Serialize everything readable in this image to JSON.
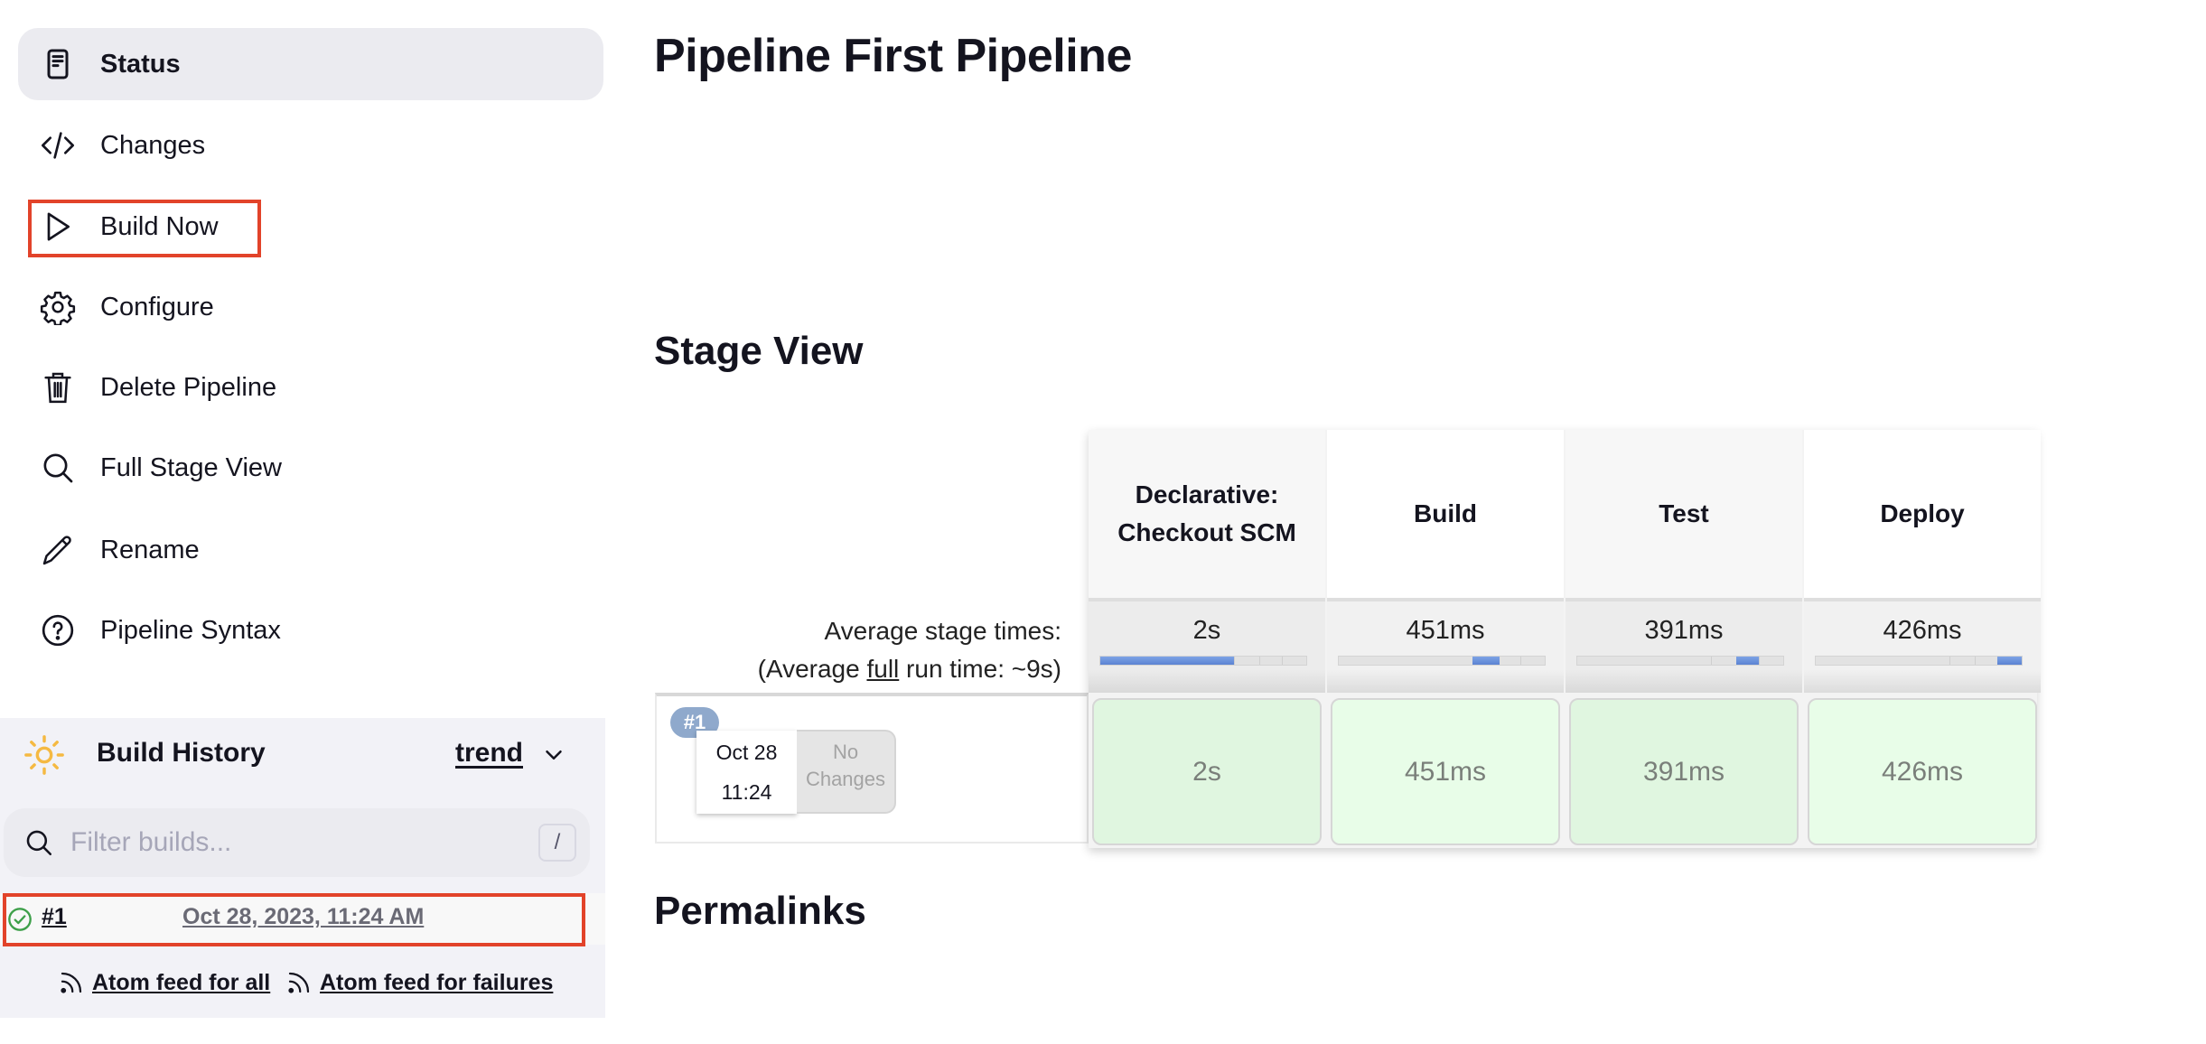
{
  "sidebar": {
    "items": [
      {
        "label": "Status",
        "icon": "status-document-icon",
        "active": true
      },
      {
        "label": "Changes",
        "icon": "code-icon"
      },
      {
        "label": "Build Now",
        "icon": "play-icon",
        "highlighted": true
      },
      {
        "label": "Configure",
        "icon": "gear-icon"
      },
      {
        "label": "Delete Pipeline",
        "icon": "trash-icon"
      },
      {
        "label": "Full Stage View",
        "icon": "search-icon"
      },
      {
        "label": "Rename",
        "icon": "pencil-icon"
      },
      {
        "label": "Pipeline Syntax",
        "icon": "help-icon"
      }
    ]
  },
  "build_history": {
    "title": "Build History",
    "icon": "sun-icon",
    "trend_label": "trend",
    "filter": {
      "placeholder": "Filter builds...",
      "value": "",
      "shortcut": "/"
    },
    "builds": [
      {
        "number": "#1",
        "date": "Oct 28, 2023, 11:24 AM",
        "status": "success",
        "highlighted": true
      }
    ],
    "feeds": {
      "all": "Atom feed for all",
      "failures": "Atom feed for failures"
    }
  },
  "main": {
    "title": "Pipeline First Pipeline",
    "stage_view_heading": "Stage View",
    "permalinks_heading": "Permalinks",
    "stage_view": {
      "avg_label_line1": "Average stage times:",
      "avg_label_prefix": "(Average ",
      "avg_label_link": "full",
      "avg_label_suffix": " run time: ~9s)",
      "stages": [
        {
          "name": "Declarative: Checkout SCM",
          "avg": "2s",
          "avg_share_start": 0.0,
          "avg_share_end": 0.65
        },
        {
          "name": "Build",
          "avg": "451ms",
          "avg_share_start": 0.65,
          "avg_share_end": 0.78
        },
        {
          "name": "Test",
          "avg": "391ms",
          "avg_share_start": 0.77,
          "avg_share_end": 0.88
        },
        {
          "name": "Deploy",
          "avg": "426ms",
          "avg_share_start": 0.88,
          "avg_share_end": 1.0
        }
      ],
      "runs": [
        {
          "badge": "#1",
          "date": "Oct 28",
          "time": "11:24",
          "changes": "No Changes",
          "durations": [
            "2s",
            "451ms",
            "391ms",
            "426ms"
          ],
          "status": "success"
        }
      ]
    }
  },
  "colors": {
    "highlight": "#e2432a",
    "accent_blue": "#5b83d2",
    "success_green": "#3ea04a",
    "sun": "#f5b942"
  }
}
